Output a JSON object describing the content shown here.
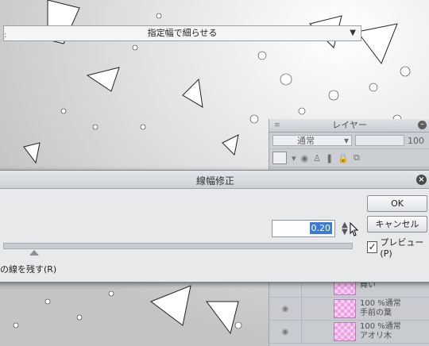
{
  "layer_panel": {
    "title": "レイヤー",
    "blend_mode": "通常",
    "opacity_partial": "100",
    "layers": [
      {
        "opacity_mode": "",
        "name": "舞い"
      },
      {
        "opacity_mode": "100 %通常",
        "name": "手前の葉"
      },
      {
        "opacity_mode": "100 %通常",
        "name": "アオリ木"
      }
    ]
  },
  "dialog": {
    "title": "線幅修正",
    "mode_select": "指定幅で細らせる",
    "width_value": "0.20",
    "keep_lines_label": "の線を残す(R)",
    "ok_label": "OK",
    "cancel_label": "キャンセル",
    "preview_label": "プレビュー(P)",
    "preview_checked": "✓"
  },
  "colors": {
    "layer_thumb": "#f39be6",
    "selection": "#3b7bd6"
  }
}
